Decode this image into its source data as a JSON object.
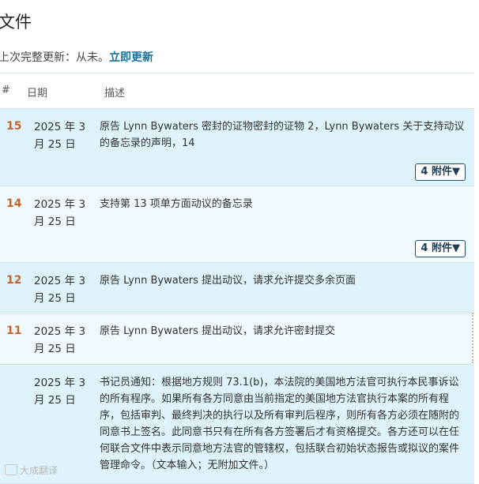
{
  "page": {
    "title": "文件",
    "last_update_label": "上次完整更新：从未。",
    "update_now_link": "立即更新"
  },
  "table": {
    "columns": [
      "#",
      "日期",
      "描述"
    ],
    "rows": [
      {
        "num": "15",
        "date": "2025 年 3 月 25 日",
        "desc": "原告 Lynn Bywaters 密封的证物密封的证物 2，Lynn Bywaters 关于支持动议的备忘录的声明，14",
        "attachments": "4 附件▼"
      },
      {
        "num": "14",
        "date": "2025 年 3 月 25 日",
        "desc": "支持第 13 项单方面动议的备忘录",
        "attachments": "4 附件▼"
      },
      {
        "num": "12",
        "date": "2025 年 3 月 25 日",
        "desc": "原告 Lynn Bywaters 提出动议，请求允许提交多余页面"
      },
      {
        "num": "11",
        "date": "2025 年 3 月 25 日",
        "desc": "原告 Lynn Bywaters 提出动议，请求允许密封提交"
      },
      {
        "num": "",
        "date": "2025 年 3 月 25 日",
        "desc": "书记员通知：根据地方规则 73.1(b)，本法院的美国地方法官可执行本民事诉讼的所有程序。如果所有各方同意由当前指定的美国地方法官执行本案的所有程序，包括审判、最终判决的执行以及所有审判后程序，则所有各方必须在随附的同意书上签名。此同意书只有在所有各方签署后才有资格提交。各方还可以在任何联合文件中表示同意地方法官的管辖权，包括联合初始状态报告或拟议的案件管理命令。（文本输入；无附加文件。）"
      }
    ]
  },
  "watermark": "大成翻译"
}
